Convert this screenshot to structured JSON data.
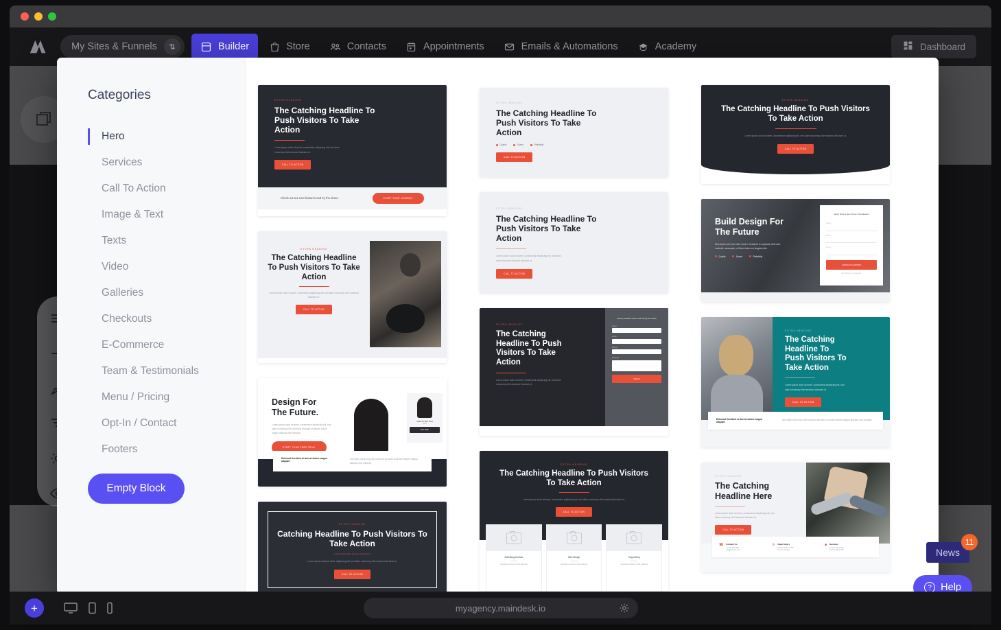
{
  "window": {
    "title": ""
  },
  "topnav": {
    "brand_icon": "maindesk-logo",
    "site_selector": {
      "label": "My Sites & Funnels",
      "swap_icon": "swap-vertical-icon"
    },
    "items": [
      {
        "label": "Builder",
        "icon": "builder-icon",
        "active": true
      },
      {
        "label": "Store",
        "icon": "store-bag-icon",
        "active": false
      },
      {
        "label": "Contacts",
        "icon": "contacts-people-icon",
        "active": false
      },
      {
        "label": "Appointments",
        "icon": "calendar-icon",
        "active": false
      },
      {
        "label": "Emails & Automations",
        "icon": "envelope-icon",
        "active": false
      },
      {
        "label": "Academy",
        "icon": "graduation-diamond-icon",
        "active": false
      }
    ],
    "dashboard": {
      "label": "Dashboard",
      "icon": "grid-dashboard-icon"
    }
  },
  "left_toolbar": {
    "shape_icon": "square-layers-icon",
    "items": [
      {
        "icon": "layers-menu-icon"
      },
      {
        "icon": "plus-add-icon"
      },
      {
        "icon": "paintbrush-icon"
      },
      {
        "icon": "filter-funnel-icon"
      },
      {
        "icon": "gear-settings-icon"
      },
      {
        "icon": "eye-preview-icon"
      }
    ]
  },
  "modal": {
    "categories_title": "Categories",
    "categories": [
      {
        "label": "Hero",
        "active": true
      },
      {
        "label": "Services",
        "active": false
      },
      {
        "label": "Call To Action",
        "active": false
      },
      {
        "label": "Image & Text",
        "active": false
      },
      {
        "label": "Texts",
        "active": false
      },
      {
        "label": "Video",
        "active": false
      },
      {
        "label": "Galleries",
        "active": false
      },
      {
        "label": "Checkouts",
        "active": false
      },
      {
        "label": "E-Commerce",
        "active": false
      },
      {
        "label": "Team & Testimonials",
        "active": false
      },
      {
        "label": "Menu / Pricing",
        "active": false
      },
      {
        "label": "Opt-In / Contact",
        "active": false
      },
      {
        "label": "Footers",
        "active": false
      }
    ],
    "empty_block_label": "Empty Block",
    "accent_color": "#5a4ff3"
  },
  "templates": {
    "common": {
      "eyebrow": "EXTRA HEADING",
      "headline": "The Catching Headline To Push Visitors To Take Action",
      "lorem": "Lorem ipsum dolor sit amet, consectetur adipiscing elit, sed diam nonummy nibh euismod tincidunt ut.",
      "cta": "CALL TO ACTION"
    },
    "t1": {
      "eyebrow": "EXTRA HEADING",
      "headline": "The Catching Headline To Push Visitors To Take Action",
      "lorem": "Lorem ipsum dolor sit amet, consectetur adipiscing elit, sed diam nonummy nibh euismod tincidunt ut.",
      "cta": "CALL TO ACTION",
      "strip_text": "Check out our new features and try the demo",
      "strip_button": "START YOUR JOURNEY"
    },
    "t2": {
      "eyebrow": "EXTRA HEADING",
      "headline": "The Catching Headline To Push Visitors To Take Action",
      "ticks": [
        "Quality",
        "Speed",
        "Reliability"
      ],
      "cta": "CALL TO ACTION"
    },
    "t3": {
      "eyebrow": "EXTRA HEADING",
      "headline": "The Catching Headline To Push Visitors To Take Action",
      "lorem": "Lorem ipsum dolor sit amet, consectetur adipiscing elit, sed diam nonummy nibh euismod tincidunt ut.",
      "cta": "CALL TO ACTION"
    },
    "t4": {
      "eyebrow": "EXTRA HEADING",
      "headline": "The Catching Headline To Push Visitors To Take Action",
      "lorem": "Lorem ipsum dolor sit amet, consectetur adipiscing elit, sed diam nonummy nibh euismod tincidunt ut.",
      "cta": "CALL TO ACTION",
      "image": "chef-plating-food-photo"
    },
    "t5": {
      "eyebrow": "EXTRA HEADING",
      "headline": "The Catching Headline To Push Visitors To Take Action",
      "lorem": "Lorem ipsum dolor sit amet, consectetur adipiscing elit, sed diam nonummy nibh euismod tincidunt ut.",
      "cta": "CALL TO ACTION"
    },
    "t6": {
      "headline": "Build Design For The Future",
      "lorem": "Duis autem vel eum iriure dolor in hendrerit in vulputate velit esse molestie consequat, vel illum dolore eu feugiat nulla.",
      "ticks": [
        "Quality",
        "Speed",
        "Reliability"
      ],
      "form_title": "Apply Now & Get A Free Consultation",
      "form_fields": [
        "Name",
        "Email",
        "Phone"
      ],
      "form_button": "CONSULT A EXPERT",
      "form_note": "We will keep your data safe",
      "image": "gym-workout-photo"
    },
    "t7": {
      "headline": "Design For The Future.",
      "lorem": "Lorem ipsum dolor sit amet, consectetur adipiscing elit, sed diam nonummy nibh euismod tincidunt ut laoreet dolore magna aliquam erat volutpat.",
      "cta": "START YOUR FREE TRIAL",
      "product_title": "SPECIAL BAG 2019",
      "product_side_title": "SPECIAL BAG 2019",
      "product_price": "$129",
      "product_button": "BUY NOW",
      "footer_title": "Euismod tincidunt ut laoreet dolore magna aliquam",
      "footer_text": "Sed diam nonummy nibh euismod tincidunt ut laoreet dolore magna aliquam erat volutpat.",
      "image": "black-backpack-product-photo"
    },
    "t8": {
      "eyebrow": "EXTRA HEADING",
      "headline": "The Catching Headline To Push Visitors To Take Action",
      "lorem": "Lorem ipsum dolor sit amet, consectetur adipiscing elit, sed diam nonummy nibh euismod tincidunt ut.",
      "form_title": "Catchy headline about submitting the action",
      "form_fields": [
        "Name",
        "Email",
        "Phone",
        "Message"
      ],
      "form_button": "Submit"
    },
    "t9": {
      "eyebrow": "EXTRA HEADING",
      "headline": "The Catching Headline To Push Visitors To Take Action",
      "lorem": "Lorem ipsum dolor sit amet, consectetur adipiscing elit, sed diam nonummy nibh euismod tincidunt ut.",
      "cta": "CALL TO ACTION",
      "footer_title": "Euismod tincidunt ut laoreet dolore magna aliquam",
      "footer_text": "Sed diam nonummy nibh euismod tincidunt ut laoreet dolore magna aliquam erat volutpat.",
      "image": "businesswoman-smiling-photo",
      "panel_color": "#0d7e82"
    },
    "t10": {
      "eyebrow": "EXTRA HEADING",
      "headline": "Catching Headline To Push Visitors To Take Action",
      "sub": "Lorem ipsum dolor sit amet consectetur",
      "lorem": "Lorem ipsum dolor sit amet, adipiscing elit, sed diam nonummy nibh euismod tincidunt ut."
    },
    "t11": {
      "eyebrow": "EXTRA HEADING",
      "headline": "The Catching Headline To Push Visitors To Take Action",
      "lorem": "Lorem ipsum dolor sit amet, consectetur adipiscing elit, sed diam nonummy nibh euismod tincidunt ut.",
      "cta": "CALL TO ACTION",
      "cards": [
        {
          "title": "Marketing and Ads",
          "text": "Sed diam nonummy nibh euismod"
        },
        {
          "title": "Web Design",
          "text": "Sed diam nonummy nibh euismod"
        },
        {
          "title": "Copywriting",
          "text": "Sed diam nonummy nibh euismod"
        }
      ]
    },
    "t12": {
      "eyebrow": "EXTRA HEADING",
      "headline": "The Catching Headline Here",
      "lorem": "Lorem ipsum dolor sit amet, consectetur adipiscing elit, sed diam nonummy nibh euismod tincidunt ut.",
      "cta": "CALL TO ACTION",
      "image": "team-high-five-photo",
      "info": [
        {
          "icon": "phone-icon",
          "title": "Contact Us",
          "lines": [
            "+1 234 562 9982",
            "info@domain.com"
          ]
        },
        {
          "icon": "clock-icon",
          "title": "Open Hours",
          "lines": [
            "Mon-Fri 9 AM - 6 PM",
            "Sat-Sun Closed"
          ]
        },
        {
          "icon": "briefcase-icon",
          "title": "Services",
          "lines": [
            "Service Name One",
            "Service Name Two"
          ]
        }
      ]
    }
  },
  "bottombar": {
    "add_icon": "plus-add-icon",
    "devices": [
      {
        "icon": "desktop-icon"
      },
      {
        "icon": "tablet-icon"
      },
      {
        "icon": "mobile-icon"
      }
    ],
    "url": "myagency.maindesk.io",
    "url_gear_icon": "gear-settings-icon"
  },
  "news": {
    "label": "News",
    "count": "11"
  },
  "help": {
    "label": "Help",
    "icon": "question-circle-icon"
  }
}
